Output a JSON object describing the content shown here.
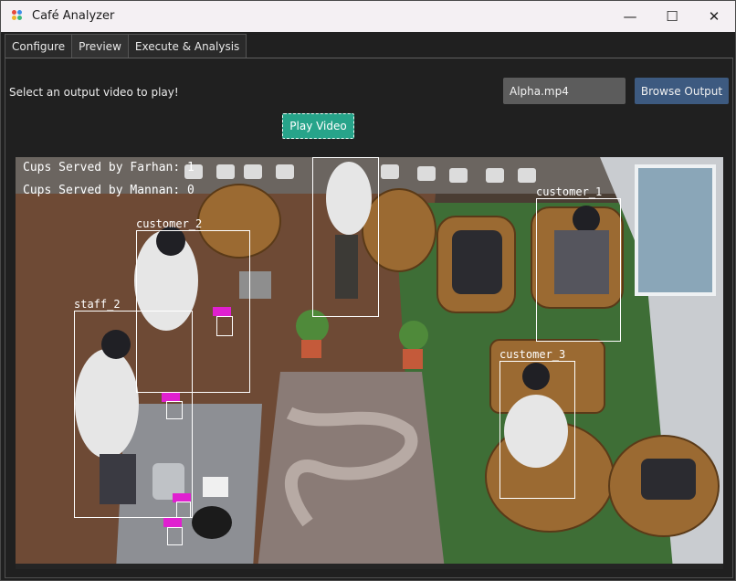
{
  "window": {
    "title": "Café Analyzer",
    "controls": {
      "minimize": "—",
      "maximize": "☐",
      "close": "✕"
    }
  },
  "tabs": [
    {
      "label": "Configure",
      "active": false
    },
    {
      "label": "Preview",
      "active": true
    },
    {
      "label": "Execute & Analysis",
      "active": false
    }
  ],
  "preview": {
    "prompt": "Select an output video to play!",
    "selected_file": "Alpha.mp4",
    "browse_label": "Browse Output",
    "play_label": "Play Video"
  },
  "video": {
    "overlay_lines": [
      "Cups Served by Farhan: 1",
      "Cups Served by Mannan: 0"
    ],
    "detections": [
      {
        "label": "customer_2"
      },
      {
        "label": "staff_2"
      },
      {
        "label": "customer_1"
      },
      {
        "label": "customer_3"
      },
      {
        "label": ""
      }
    ]
  },
  "colors": {
    "accent_play": "#27a48a",
    "browse_button": "#3d5a80",
    "cup_tag": "#e020d0",
    "bounding_box": "#ffffff"
  }
}
